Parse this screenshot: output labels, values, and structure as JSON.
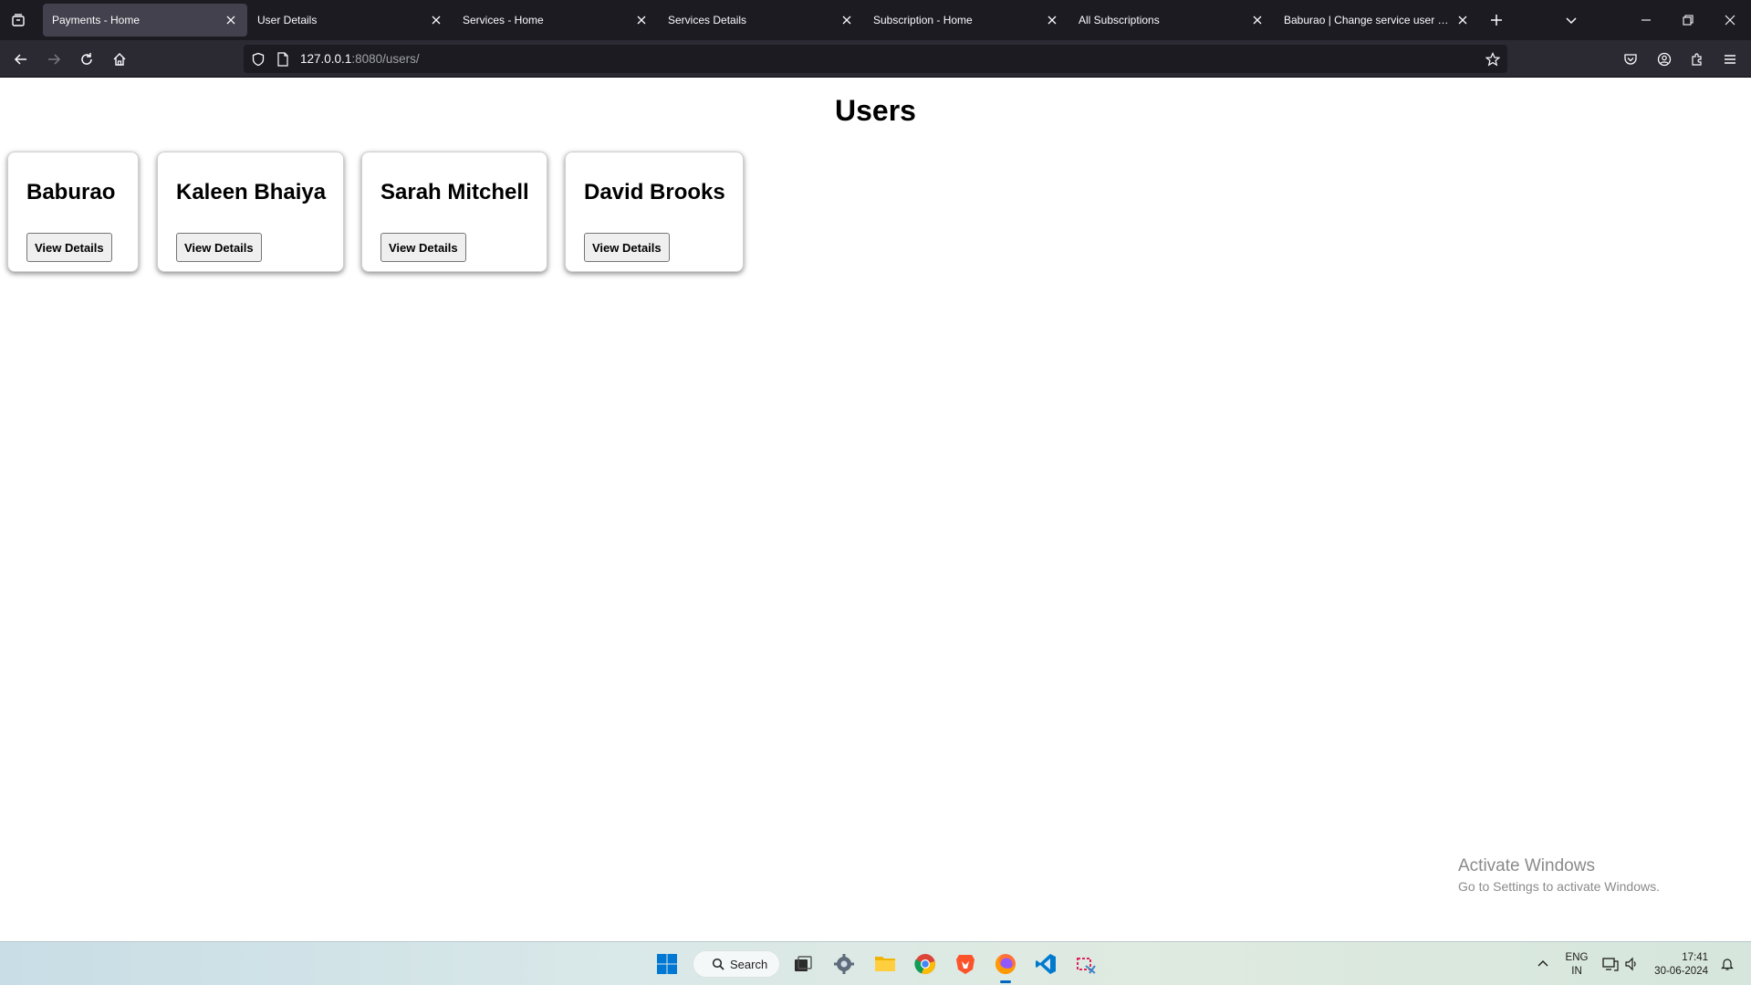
{
  "browser": {
    "tabs": [
      {
        "title": "Payments - Home",
        "active": true
      },
      {
        "title": "User Details",
        "active": false
      },
      {
        "title": "Services - Home",
        "active": false
      },
      {
        "title": "Services Details",
        "active": false
      },
      {
        "title": "Subscription - Home",
        "active": false
      },
      {
        "title": "All Subscriptions",
        "active": false
      },
      {
        "title": "Baburao | Change service user | Django site admin",
        "active": false
      }
    ],
    "url_host": "127.0.0.1",
    "url_rest": ":8080/users/"
  },
  "page": {
    "title": "Users",
    "users": [
      {
        "name": "Baburao",
        "button": "View Details"
      },
      {
        "name": "Kaleen Bhaiya",
        "button": "View Details"
      },
      {
        "name": "Sarah Mitchell",
        "button": "View Details"
      },
      {
        "name": "David Brooks",
        "button": "View Details"
      }
    ]
  },
  "watermark": {
    "line1": "Activate Windows",
    "line2": "Go to Settings to activate Windows."
  },
  "taskbar": {
    "search_label": "Search",
    "language_top": "ENG",
    "language_bottom": "IN",
    "time": "17:41",
    "date": "30-06-2024"
  },
  "colors": {
    "chrome_dark": "#1c1b22",
    "toolbar": "#2b2a33",
    "active_tab": "#42414d",
    "accent": "#0067c0"
  }
}
